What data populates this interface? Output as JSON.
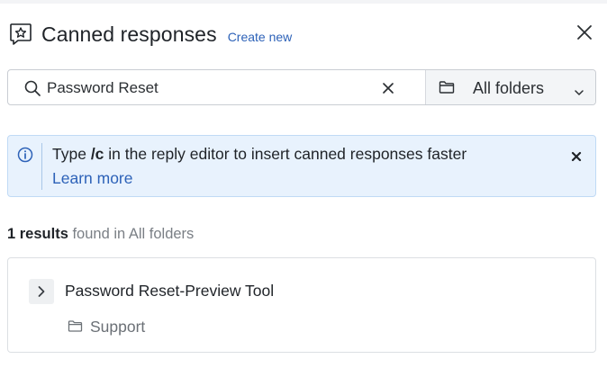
{
  "header": {
    "title": "Canned responses",
    "create_new_label": "Create new"
  },
  "search": {
    "value": "Password Reset"
  },
  "folder_select": {
    "selected": "All folders"
  },
  "banner": {
    "text_before": "Type ",
    "shortcut": "/c",
    "text_after": " in the reply editor to insert canned responses faster",
    "link_label": "Learn more"
  },
  "results": {
    "count_label": "1 results",
    "suffix": " found in All folders",
    "items": [
      {
        "title": "Password Reset-Preview Tool",
        "folder": "Support"
      }
    ]
  },
  "colors": {
    "accent": "#2d62b8",
    "banner_bg": "#e8f2fd",
    "banner_border": "#c0daf5"
  }
}
